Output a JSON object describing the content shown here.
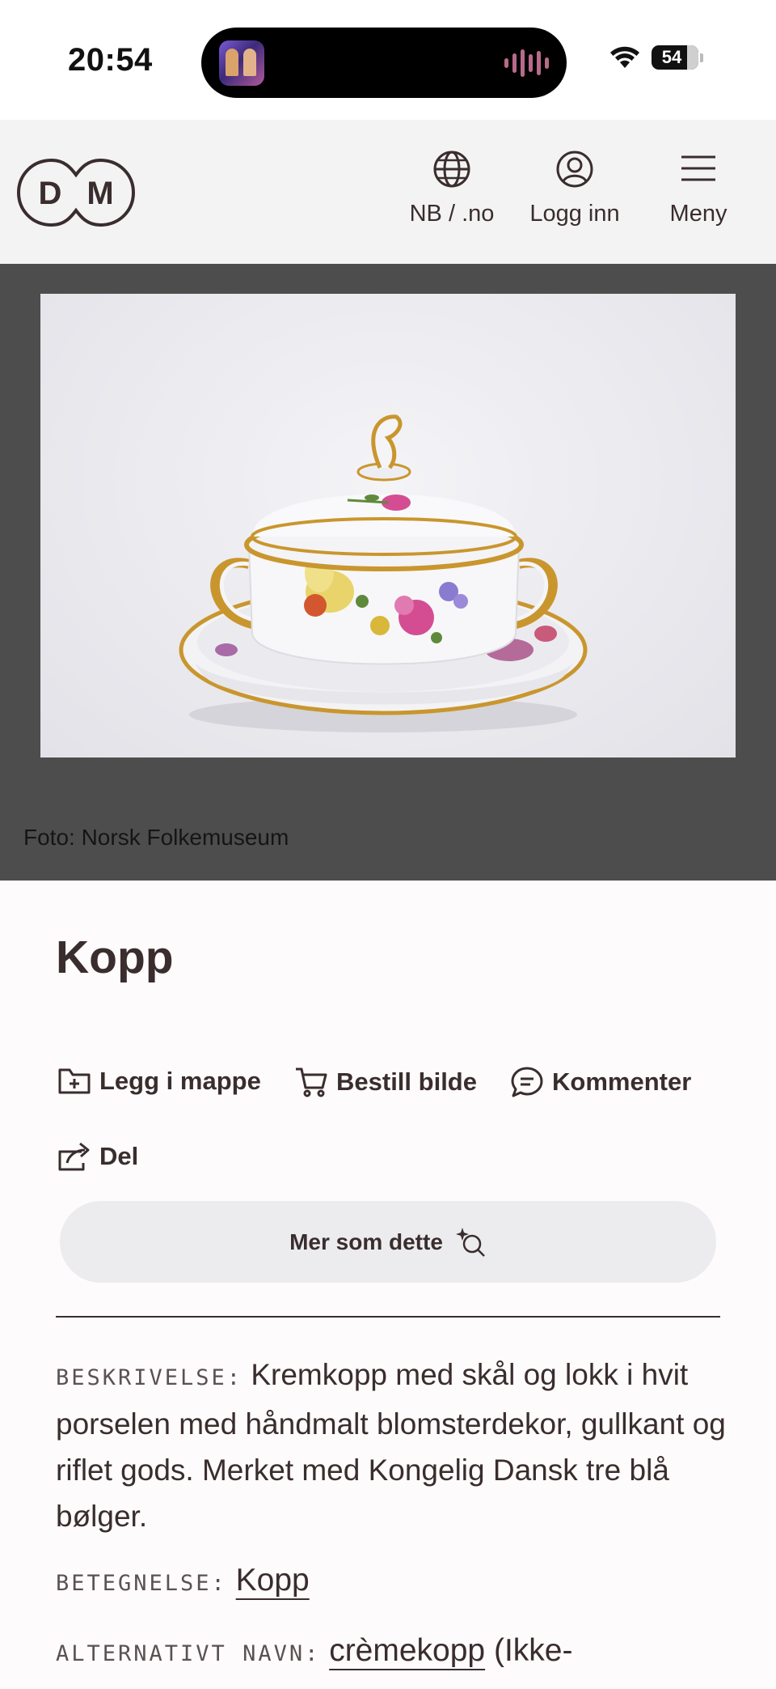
{
  "status_bar": {
    "time": "20:54",
    "battery": "54"
  },
  "header": {
    "logo_letters": [
      "D",
      "M"
    ],
    "nav": [
      {
        "label": "NB / .no",
        "icon": "globe-icon"
      },
      {
        "label": "Logg inn",
        "icon": "user-circle-icon"
      },
      {
        "label": "Meny",
        "icon": "hamburger-menu-icon"
      }
    ]
  },
  "media": {
    "caption": "Foto: Norsk Folkemuseum"
  },
  "object": {
    "title": "Kopp",
    "actions": {
      "add_to_folder": "Legg i mappe",
      "order_image": "Bestill bilde",
      "comment": "Kommenter",
      "share": "Del"
    },
    "more_like_this": "Mer som dette",
    "description_label": "BESKRIVELSE:",
    "description": "Kremkopp med skål og lokk i hvit porselen med håndmalt blomsterdekor, gullkant og riflet gods. Merket med Kongelig Dansk tre blå bølger.",
    "designation_label": "BETEGNELSE:",
    "designation": "Kopp",
    "alt_name_label": "ALTERNATIVT NAVN:",
    "alt_name": "crèmekopp",
    "alt_name_note": "(Ikke-"
  },
  "colors": {
    "text": "#3a2d2e",
    "header_bg": "#f4f3f4",
    "image_bg": "#4d4d4d",
    "button_bg": "#ececee"
  }
}
